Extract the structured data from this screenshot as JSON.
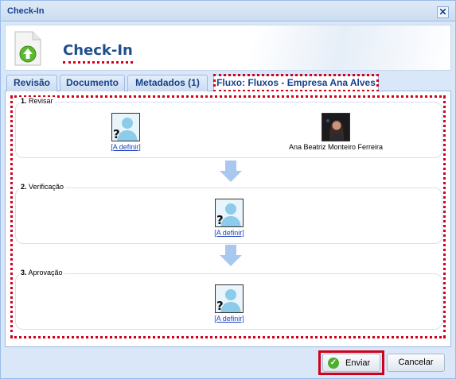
{
  "window": {
    "title": "Check-In",
    "close_label": "✕"
  },
  "header": {
    "title": "Check-In",
    "icon": "upload-document-icon"
  },
  "tabs": [
    {
      "label": "Revisão",
      "active": false
    },
    {
      "label": "Documento",
      "active": false
    },
    {
      "label": "Metadados (1)",
      "active": false
    },
    {
      "label": "Fluxo: Fluxos - Empresa Ana Alves",
      "active": true
    }
  ],
  "workflow": {
    "stages": [
      {
        "number": "1.",
        "name": "Revisar",
        "people": [
          {
            "type": "undefined",
            "label": "[A definir]"
          },
          {
            "type": "user",
            "label": "Ana Beatriz Monteiro Ferreira"
          }
        ]
      },
      {
        "number": "2.",
        "name": "Verificação",
        "people": [
          {
            "type": "undefined",
            "label": "[A definir]"
          }
        ]
      },
      {
        "number": "3.",
        "name": "Aprovação",
        "people": [
          {
            "type": "undefined",
            "label": "[A definir]"
          }
        ]
      }
    ]
  },
  "footer": {
    "send_label": "Enviar",
    "cancel_label": "Cancelar"
  },
  "colors": {
    "accent": "#15428b",
    "highlight": "#d0021b",
    "arrow": "#a9c8f0"
  }
}
